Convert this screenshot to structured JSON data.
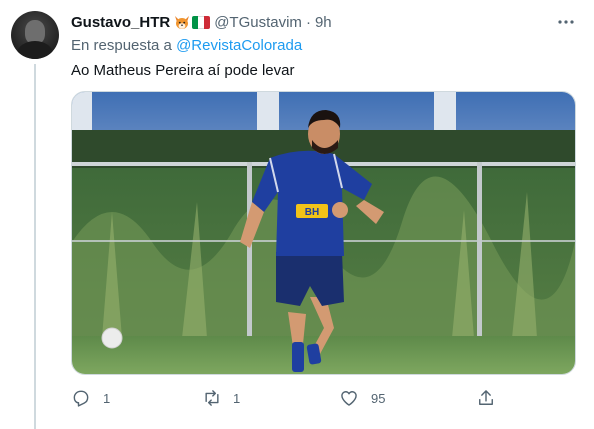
{
  "tweet": {
    "author_name": "Gustavo_HTR",
    "author_handle": "@TGustavim",
    "separator": "·",
    "time": "9h",
    "reply_prefix": "En respuesta a",
    "reply_mention": "@RevistaColorada",
    "text": "Ao Matheus Pereira aí pode levar",
    "media": {
      "shirt_sponsor": "BH"
    },
    "flag_colors": [
      "#009246",
      "#ffffff",
      "#ce2b37"
    ]
  },
  "actions": {
    "reply": {
      "icon": "reply-icon",
      "count": "1"
    },
    "retweet": {
      "icon": "retweet-icon",
      "count": "1"
    },
    "like": {
      "icon": "heart-icon",
      "count": "95"
    },
    "share": {
      "icon": "share-icon"
    }
  },
  "colors": {
    "accent": "#1d9bf0",
    "secondary_text": "#536471",
    "primary_text": "#0f1419",
    "jersey": "#1f3fa0"
  }
}
